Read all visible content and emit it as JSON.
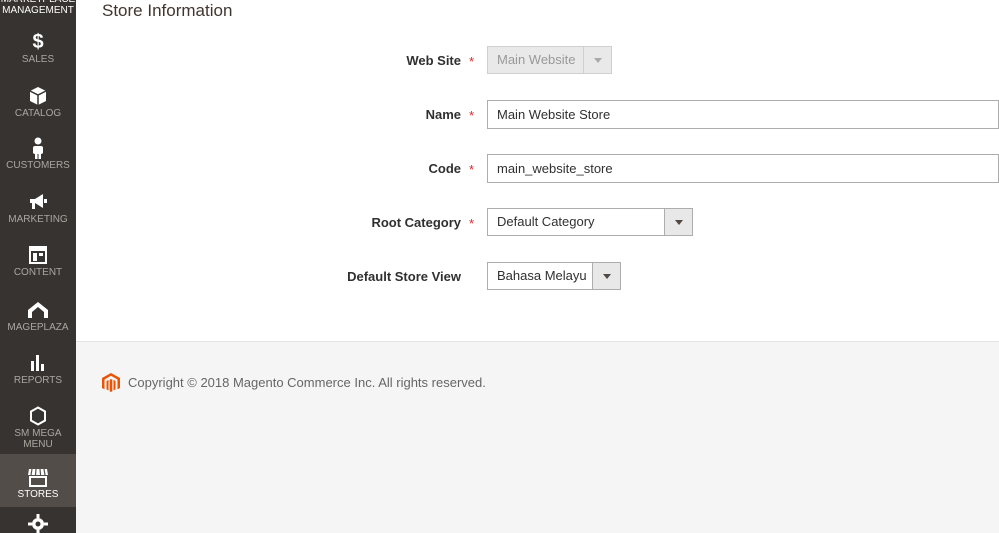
{
  "sidebar": {
    "top_label": "MARKETPLACE MANAGEMENT",
    "items": [
      {
        "label": "SALES",
        "icon": "dollar-icon"
      },
      {
        "label": "CATALOG",
        "icon": "box-icon"
      },
      {
        "label": "CUSTOMERS",
        "icon": "person-icon"
      },
      {
        "label": "MARKETING",
        "icon": "megaphone-icon"
      },
      {
        "label": "CONTENT",
        "icon": "layout-icon"
      },
      {
        "label": "MAGEPLAZA",
        "icon": "mageplaza-icon"
      },
      {
        "label": "REPORTS",
        "icon": "bar-chart-icon"
      },
      {
        "label": "SM MEGA MENU",
        "icon": "hexagon-icon"
      },
      {
        "label": "STORES",
        "icon": "storefront-icon"
      },
      {
        "label": "",
        "icon": "gear-icon"
      }
    ],
    "active_item": "STORES"
  },
  "section": {
    "title": "Store Information"
  },
  "form": {
    "website": {
      "label": "Web Site",
      "value": "Main Website",
      "required": "*"
    },
    "name": {
      "label": "Name",
      "value": "Main Website Store",
      "required": "*"
    },
    "code": {
      "label": "Code",
      "value": "main_website_store",
      "required": "*"
    },
    "root_category": {
      "label": "Root Category",
      "value": "Default Category",
      "required": "*"
    },
    "default_store_view": {
      "label": "Default Store View",
      "value": "Bahasa Melayu"
    }
  },
  "footer": {
    "copyright": "Copyright © 2018 Magento Commerce Inc. All rights reserved."
  },
  "colors": {
    "sidebar_bg": "#373330",
    "active_bg": "#524d49",
    "required": "#e22626",
    "magento_orange": "#eb5202"
  }
}
